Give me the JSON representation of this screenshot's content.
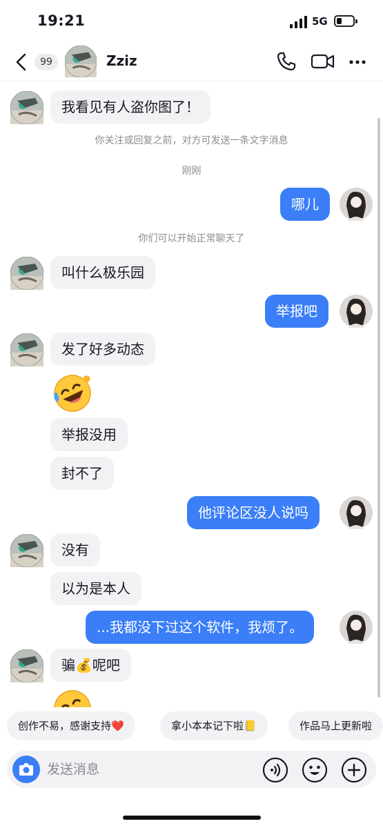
{
  "status_bar": {
    "time": "19:21",
    "network": "5G",
    "battery_level": 0.3
  },
  "nav": {
    "unread_count": "99",
    "contact_name": "Zziz",
    "icons": {
      "back": "back-chevron-icon",
      "call": "phone-icon",
      "video": "video-camera-icon",
      "more": "more-dots-icon"
    }
  },
  "chat": {
    "messages": [
      {
        "type": "text",
        "from": "them",
        "text": "我看见有人盗你图了！"
      },
      {
        "type": "system",
        "text": "你关注或回复之前，对方可发送一条文字消息"
      },
      {
        "type": "system",
        "text": "刚刚"
      },
      {
        "type": "text",
        "from": "me",
        "text": "哪儿"
      },
      {
        "type": "system",
        "text": "你们可以开始正常聊天了"
      },
      {
        "type": "text",
        "from": "them",
        "text": "叫什么极乐园"
      },
      {
        "type": "text",
        "from": "me",
        "text": "举报吧"
      },
      {
        "type": "text",
        "from": "them",
        "text": "发了好多动态"
      },
      {
        "type": "emoji",
        "from": "them",
        "name": "rolling-on-floor-laughing-emoji"
      },
      {
        "type": "text",
        "from": "them",
        "text": "举报没用"
      },
      {
        "type": "text",
        "from": "them",
        "text": "封不了"
      },
      {
        "type": "text",
        "from": "me",
        "text": "他评论区没人说吗"
      },
      {
        "type": "text",
        "from": "them",
        "text": "没有"
      },
      {
        "type": "text",
        "from": "them",
        "text": "以为是本人"
      },
      {
        "type": "text",
        "from": "me",
        "text": "...我都没下过这个软件，我烦了。"
      },
      {
        "type": "text",
        "from": "them",
        "text": "骗💰呢吧"
      }
    ]
  },
  "quick_replies": [
    "创作不易，感谢支持❤️",
    "拿小本本记下啦📒",
    "作品马上更新啦"
  ],
  "input": {
    "placeholder": "发送消息",
    "icons": {
      "camera": "camera-icon",
      "voice": "voice-icon",
      "emoji": "emoji-face-icon",
      "plus": "plus-icon"
    }
  },
  "colors": {
    "accent": "#3b7ef7",
    "bubble_in": "#f2f2f4",
    "system_text": "#8a8b91"
  }
}
